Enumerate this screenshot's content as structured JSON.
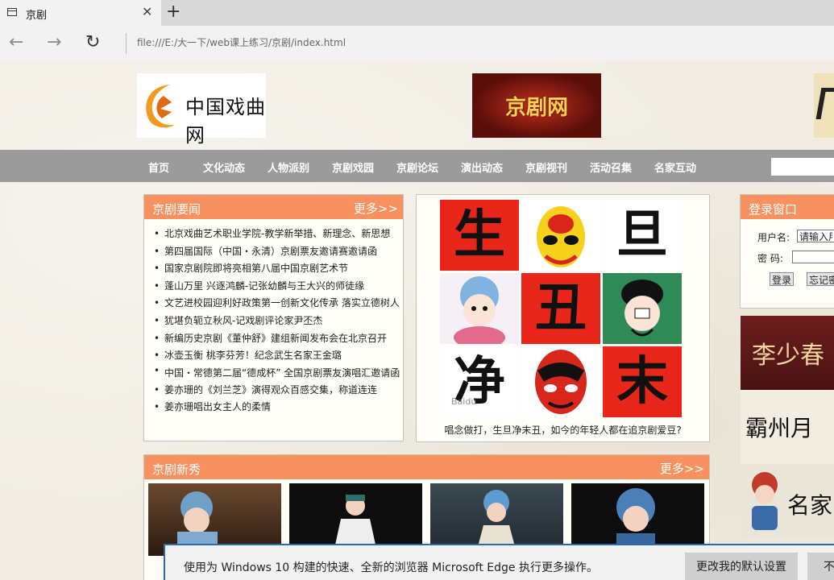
{
  "browser": {
    "tab_title": "京剧",
    "close_glyph": "✕",
    "new_tab_glyph": "+",
    "back_glyph": "←",
    "forward_glyph": "→",
    "reload_glyph": "↻",
    "address": "file:///E:/大一下/web课上练习/京剧/index.html"
  },
  "header": {
    "logo_text": "中国戏曲网",
    "banner_text": "京剧网"
  },
  "menu": {
    "items": [
      "首页",
      "文化动态",
      "人物派别",
      "京剧戏园",
      "京剧论坛",
      "演出动态",
      "京剧视刊",
      "活动召集",
      "名家互动"
    ],
    "search_value": ""
  },
  "news": {
    "title": "京剧要闻",
    "more": "更多>>",
    "items": [
      "北京戏曲艺术职业学院-教学新举措、新理念、新思想",
      "第四届国际（中国・永清）京剧票友邀请赛邀请函",
      "国家京剧院即将亮相第八届中国京剧艺术节",
      "蓬山万里 兴逐鸿麟-记张幼麟与王大兴的师徒缘",
      "文艺进校园迎利好政策第一创新文化传承 落实立德树人",
      "犹堪负轭立秋风-记戏剧评论家尹丕杰",
      "新编历史京剧《董仲舒》建组新闻发布会在北京召开",
      "冰壶玉衡 桃李芬芳！纪念武生名家王金璐",
      "中国・常德第二届“德成杯” 全国京剧票友演唱汇邀请函",
      "姜亦珊的《刘兰芝》演得观众百感交集，称道连连",
      "姜亦珊唱出女主人的柔情"
    ]
  },
  "roles": {
    "chars": [
      "生",
      "旦",
      "丑",
      "净",
      "末"
    ],
    "watermark": "Baidu",
    "caption": "唱念做打，生旦净末丑，如今的年轻人都在追京剧爱豆?"
  },
  "login": {
    "title": "登录窗口",
    "username_label": "用户名:",
    "username_value": "请输入用户名",
    "password_label": "密  码:",
    "password_value": "",
    "login_button": "登录",
    "forgot_button": "忘记密码"
  },
  "side": {
    "artist_text": "李少春",
    "poster_text": "霸州月",
    "famous_text": "名家"
  },
  "newcomers": {
    "title": "京剧新秀",
    "more": "更多>>"
  },
  "edge": {
    "message": "使用为 Windows 10 构建的快速、全新的浏览器 Microsoft Edge 执行更多操作。",
    "change_button": "更改我的默认设置",
    "dismiss_button": "不"
  },
  "colors": {
    "panel_header": "#f79160",
    "menu_bar": "#9b9b9b",
    "red_cell": "#e8261a"
  }
}
